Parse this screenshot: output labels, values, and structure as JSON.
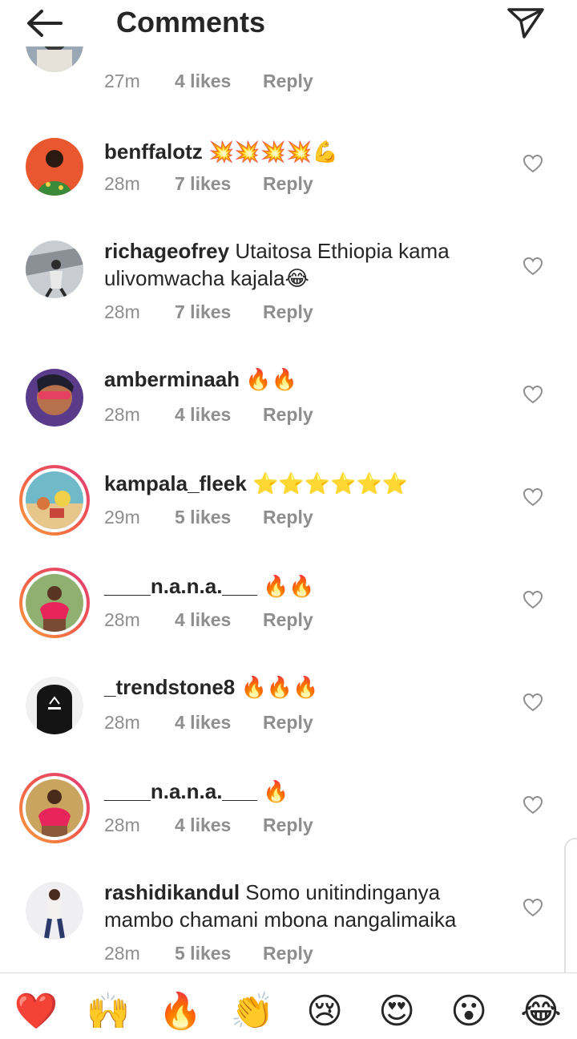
{
  "header": {
    "title": "Comments",
    "back_icon": "arrow-left-icon",
    "send_icon": "paper-plane-icon"
  },
  "reply_label": "Reply",
  "comments": [
    {
      "username": "",
      "text": "",
      "emoji": "",
      "time": "27m",
      "likes": "4 likes"
    },
    {
      "username": "benffalotz",
      "text": "",
      "emoji": "💥💥💥💥💪",
      "time": "28m",
      "likes": "7 likes"
    },
    {
      "username": "richageofrey",
      "text": "Utaitosa Ethiopia kama ulivomwacha kajala",
      "emoji": "😂",
      "time": "28m",
      "likes": "7 likes"
    },
    {
      "username": "amberminaah",
      "text": "",
      "emoji": "🔥🔥",
      "time": "28m",
      "likes": "4 likes"
    },
    {
      "username": "kampala_fleek",
      "text": "",
      "emoji": "⭐⭐⭐⭐⭐⭐",
      "time": "29m",
      "likes": "5 likes"
    },
    {
      "username": "____n.a.n.a.___",
      "text": "",
      "emoji": "🔥🔥",
      "time": "28m",
      "likes": "4 likes"
    },
    {
      "username": "_trendstone8",
      "text": "",
      "emoji": "🔥🔥🔥",
      "time": "28m",
      "likes": "4 likes"
    },
    {
      "username": "____n.a.n.a.___",
      "text": "",
      "emoji": "🔥",
      "time": "28m",
      "likes": "4 likes"
    },
    {
      "username": "rashidikandul",
      "text": "Somo unitindinganya mambo chamani mbona nangalimaika",
      "emoji": "",
      "time": "28m",
      "likes": "5 likes"
    }
  ],
  "reactions": [
    "❤️",
    "🙌",
    "🔥",
    "👏",
    "😢",
    "😍",
    "😮",
    "😂"
  ],
  "colors": {
    "accent": "#262626",
    "muted": "#8e8e8e",
    "heart_red": "#ed4956",
    "story_ring": "#f15a4b"
  }
}
